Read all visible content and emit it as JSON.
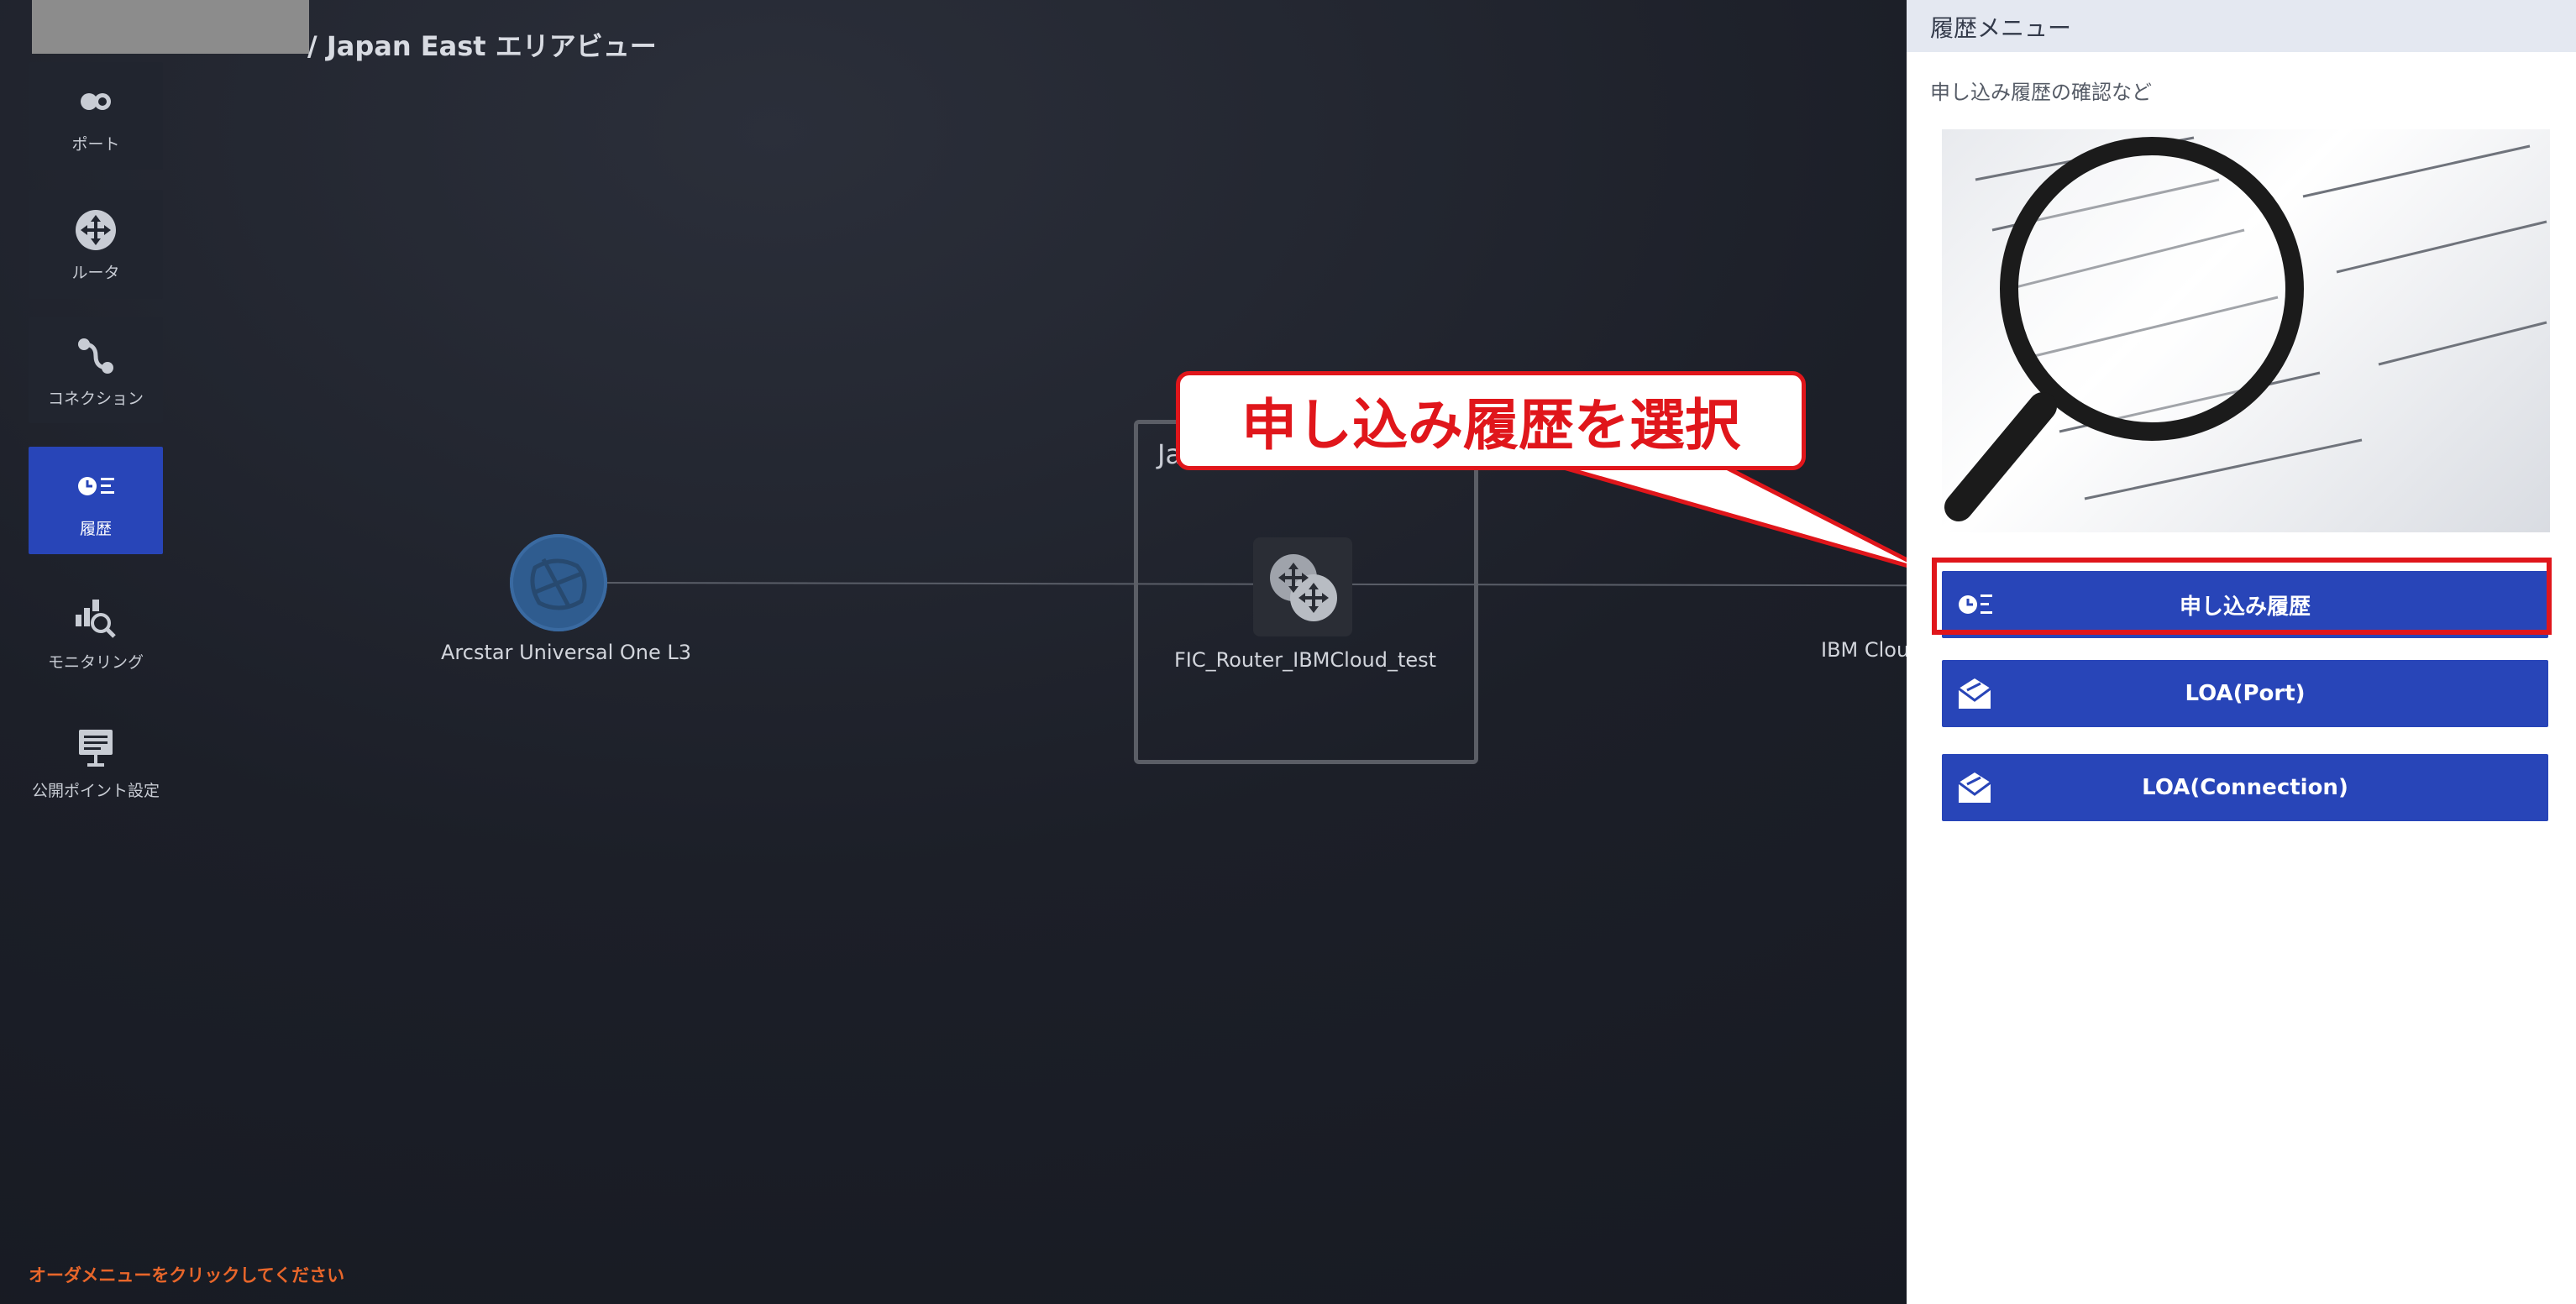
{
  "header": {
    "breadcrumb": "/ Japan East エリアビュー"
  },
  "sidebar": {
    "items": [
      {
        "label": "ポート",
        "icon": "port-icon"
      },
      {
        "label": "ルータ",
        "icon": "router-icon"
      },
      {
        "label": "コネクション",
        "icon": "connection-icon"
      },
      {
        "label": "履歴",
        "icon": "history-icon",
        "active": true
      },
      {
        "label": "モニタリング",
        "icon": "monitoring-icon"
      },
      {
        "label": "公開ポイント設定",
        "icon": "public-point-icon"
      }
    ]
  },
  "topology": {
    "cloud_node_label": "Arcstar Universal One L3",
    "area_label": "Ja",
    "router_label": "FIC_Router_IBMCloud_test",
    "ibm_label": "IBM Clou"
  },
  "footer": {
    "order_hint": "オーダメニューをクリックしてください"
  },
  "callout": {
    "text": "申し込み履歴を選択"
  },
  "panel": {
    "title": "履歴メニュー",
    "description": "申し込み履歴の確認など",
    "buttons": [
      {
        "label": "申し込み履歴",
        "icon": "history-icon"
      },
      {
        "label": "LOA(Port)",
        "icon": "envelope-icon"
      },
      {
        "label": "LOA(Connection)",
        "icon": "envelope-icon"
      }
    ]
  },
  "colors": {
    "accent": "#2845b8",
    "callout_red": "#e0161b",
    "hint_orange": "#e8662a"
  }
}
